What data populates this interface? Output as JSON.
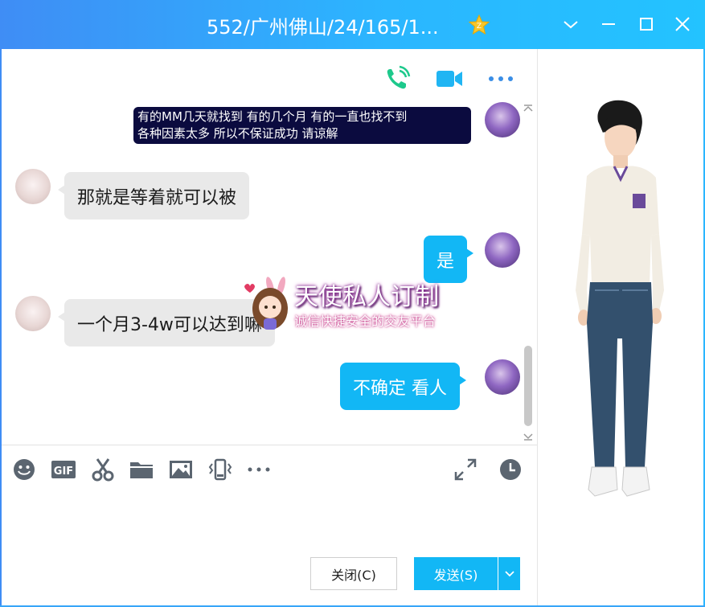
{
  "window": {
    "title": "552/广州佛山/24/165/1...",
    "badge_icon": "star-badge-icon",
    "controls": [
      "chevron-down-icon",
      "minimize-icon",
      "maximize-icon",
      "close-icon"
    ]
  },
  "header_actions": [
    "voice-call-icon",
    "video-call-icon",
    "more-icon"
  ],
  "messages": [
    {
      "side": "right",
      "type": "system",
      "text_line1": "有的MM几天就找到 有的几个月 有的一直也找不到",
      "text_line2": "各种因素太多 所以不保证成功 请谅解"
    },
    {
      "side": "left",
      "text": "那就是等着就可以被"
    },
    {
      "side": "right",
      "text": "是"
    },
    {
      "side": "left",
      "text": "一个月3-4w可以达到嘛"
    },
    {
      "side": "right",
      "text": "不确定 看人"
    }
  ],
  "watermark": {
    "line1": "天使私人订制",
    "line2": "诚信快捷安全的交友平台"
  },
  "toolbar": [
    "emoji-icon",
    "gif-icon",
    "scissors-icon",
    "folder-icon",
    "image-icon",
    "shake-icon",
    "more-tools-icon",
    "expand-icon",
    "history-icon"
  ],
  "buttons": {
    "close_label": "关闭(C)",
    "send_label": "发送(S)"
  },
  "colors": {
    "title_gradient_start": "#3f8df5",
    "title_gradient_end": "#23c3ff",
    "bubble_out": "#12b7f5",
    "bubble_in": "#e9e9e9",
    "system_banner": "#0b0b3f"
  }
}
